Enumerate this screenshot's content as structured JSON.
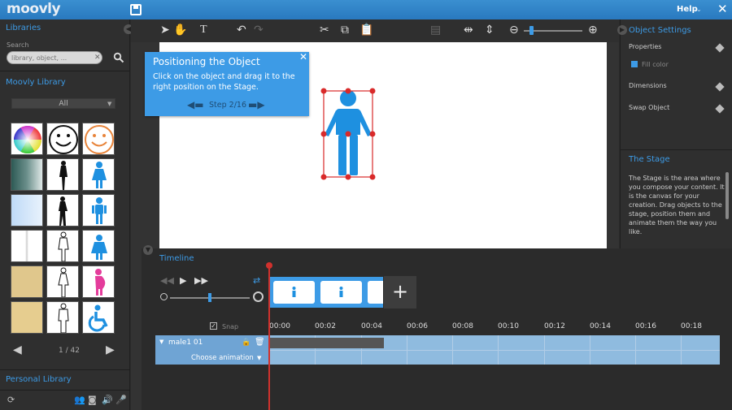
{
  "app": {
    "logo": "moovly",
    "help_label": "Help",
    "help_caret": "⌄",
    "close": "✕"
  },
  "left": {
    "libraries_title": "Libraries",
    "search_label": "Search",
    "search_placeholder": "library, object, ...",
    "moovly_library_title": "Moovly Library",
    "category": "All",
    "pager": "1 / 42",
    "personal_library_title": "Personal Library",
    "thumbs": [
      "color-wheel-thumb",
      "smiley-black-thumb",
      "smiley-orange-thumb",
      "gradient-teal-thumb",
      "woman-silhouette-thumb",
      "female-blue-icon-thumb",
      "gradient-blue-thumb",
      "woman-silhouette-2-thumb",
      "male-blue-icon-thumb",
      "white-panel-thumb",
      "woman-sketch-thumb",
      "child-blue-icon-thumb",
      "paper-texture-thumb",
      "woman-sketch-2-thumb",
      "pregnant-pink-icon-thumb",
      "paper-texture-2-thumb",
      "man-sketch-thumb",
      "wheelchair-blue-icon-thumb"
    ]
  },
  "toolbar": {
    "icons": [
      "pointer-icon",
      "hand-icon",
      "text-tool-icon",
      "undo-icon",
      "redo-icon",
      "cut-icon",
      "copy-icon",
      "paste-icon",
      "align-icon",
      "flip-horizontal-icon",
      "flip-vertical-icon",
      "zoom-out-icon",
      "zoom-in-icon"
    ],
    "zoom_level": 0.1
  },
  "tooltip": {
    "title": "Positioning the Object",
    "text": "Click on the object and drag it to the right position on the Stage.",
    "step": "Step 2/16"
  },
  "right": {
    "title": "Object Settings",
    "properties": "Properties",
    "fill_color": "Fill color",
    "dimensions": "Dimensions",
    "swap_object": "Swap Object",
    "stage_title": "The Stage",
    "stage_desc": "The Stage is the area where you compose your content. It is the canvas for your creation. Drag objects to the stage, position them and animate them the way you like."
  },
  "timeline": {
    "title": "Timeline",
    "snap_label": "Snap",
    "speed_level": 0.48,
    "ticks": [
      "00:00",
      "00:02",
      "00:04",
      "00:06",
      "00:08",
      "00:10",
      "00:12",
      "00:14",
      "00:16",
      "00:18"
    ],
    "track_name": "male1 01",
    "choose_animation": "Choose animation",
    "add_label": "+"
  },
  "colors": {
    "accent": "#3d9be6",
    "topbar": "#2f83c7",
    "playhead": "#d0312d",
    "figure": "#1e90e0",
    "selection": "#d92a2a"
  }
}
